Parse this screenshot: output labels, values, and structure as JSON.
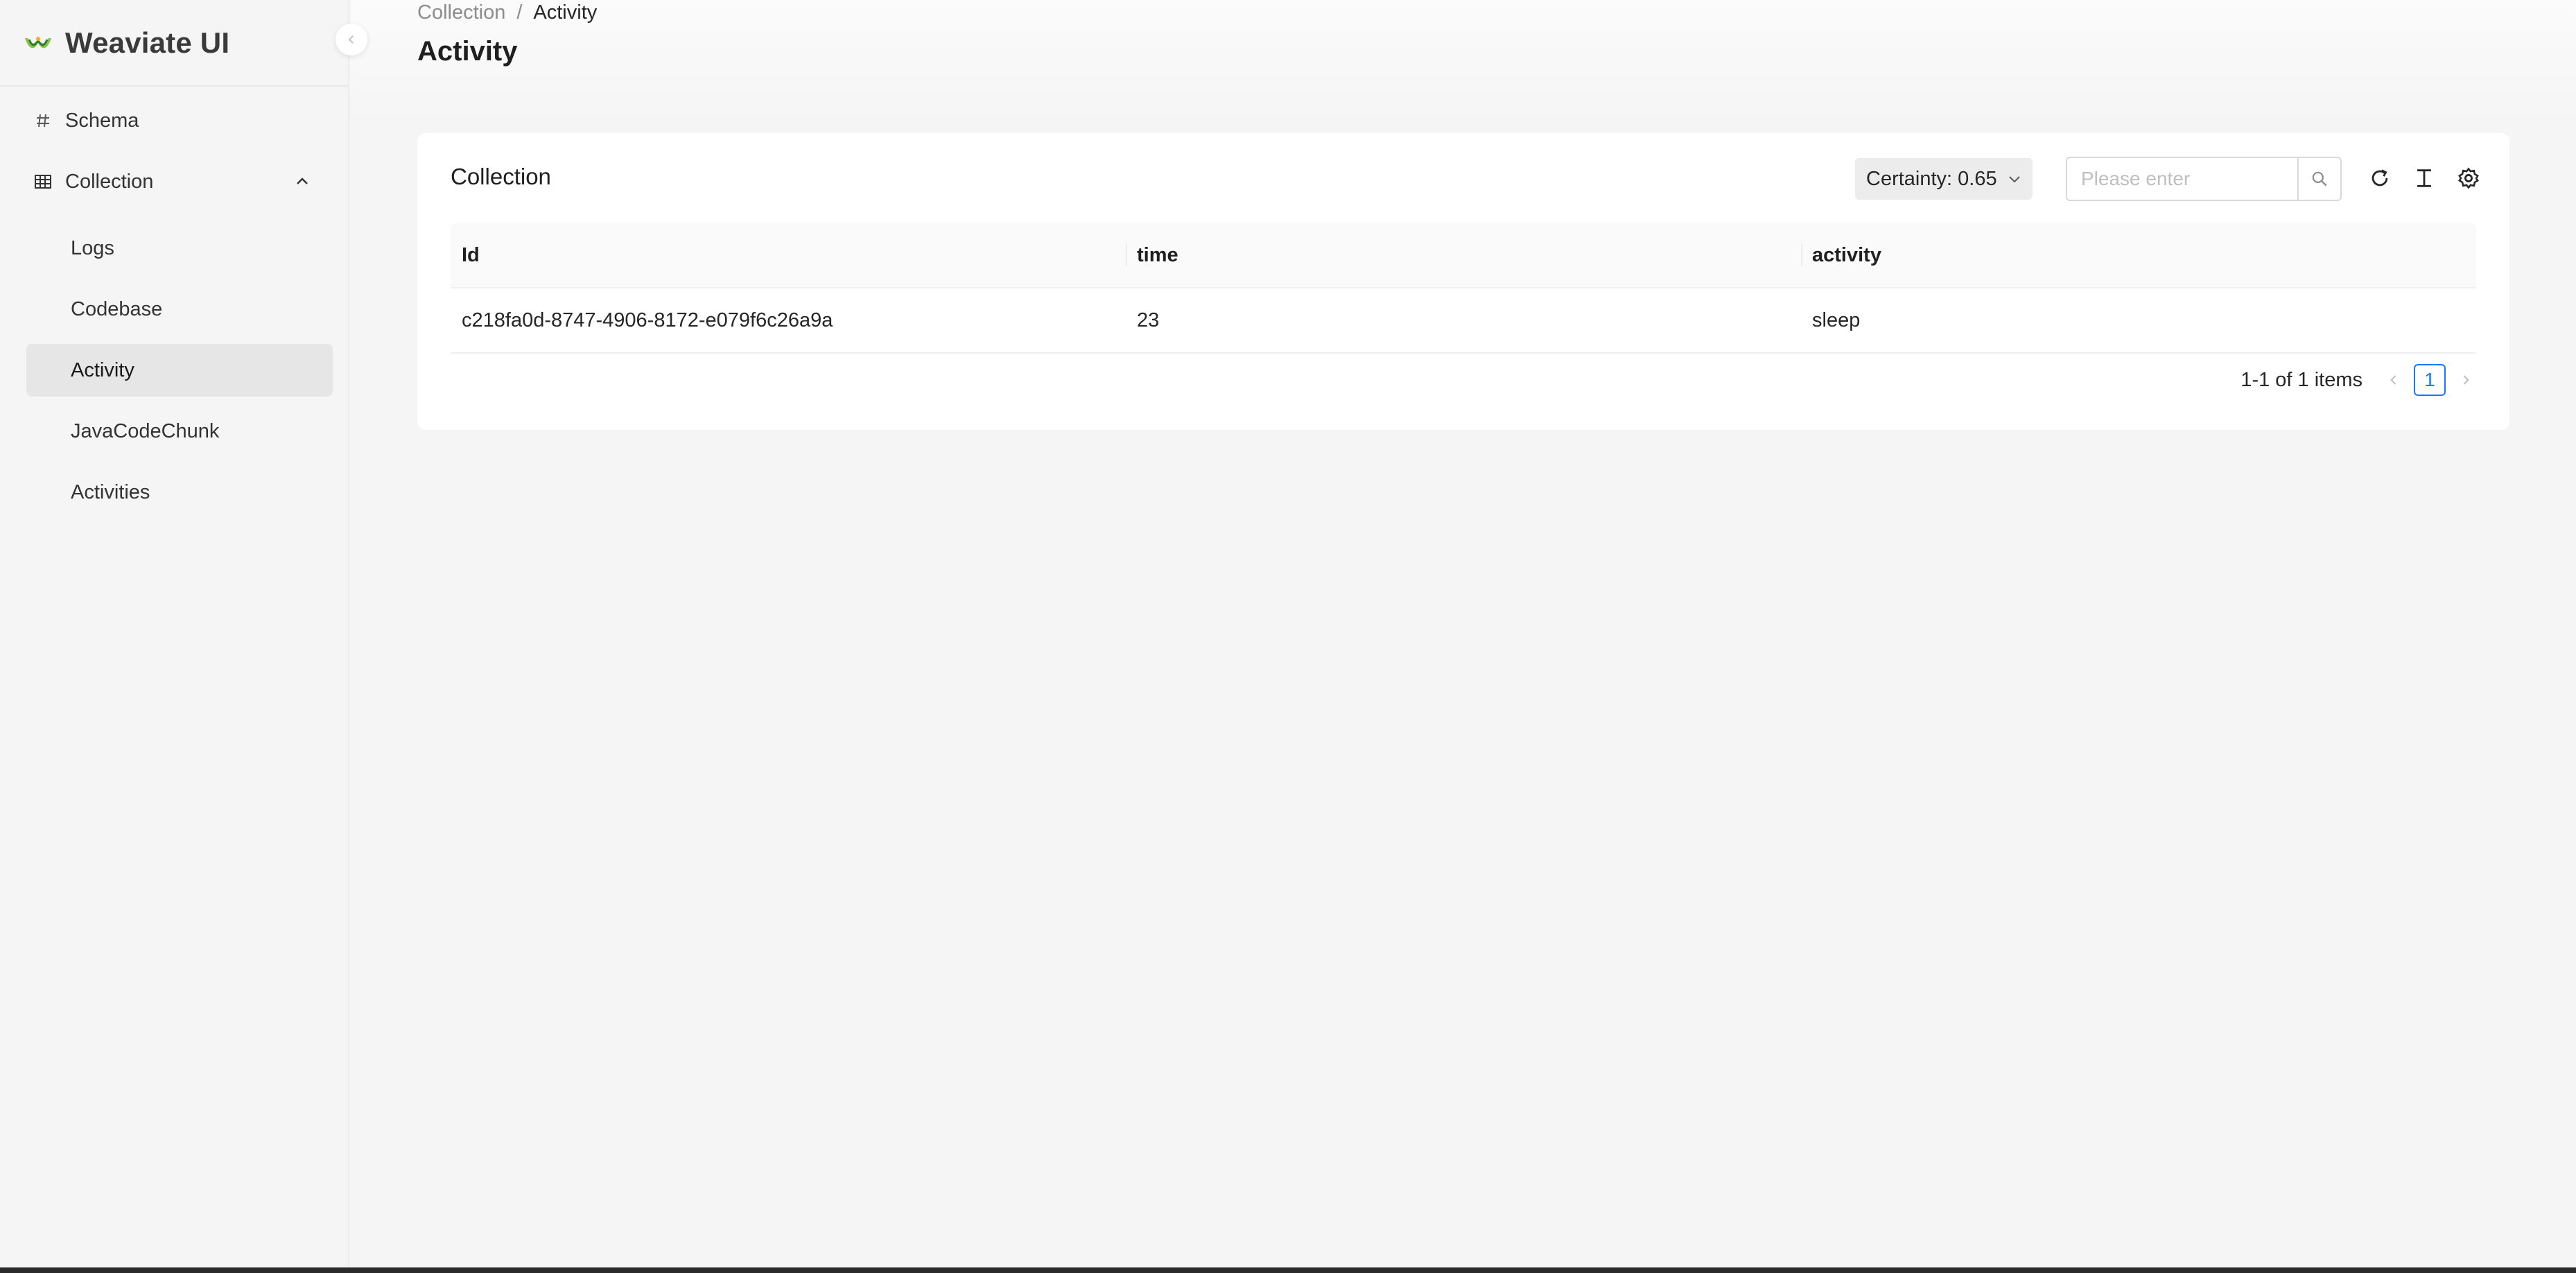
{
  "sidebar": {
    "brand": "Weaviate UI",
    "nav": {
      "schema": "Schema",
      "collection": "Collection"
    },
    "items": [
      "Logs",
      "Codebase",
      "Activity",
      "JavaCodeChunk",
      "Activities"
    ],
    "active_item": "Activity"
  },
  "breadcrumb": {
    "parent": "Collection",
    "separator": "/",
    "current": "Activity"
  },
  "page": {
    "title": "Activity"
  },
  "card": {
    "title": "Collection",
    "certainty_label": "Certainty: 0.65",
    "search_placeholder": "Please enter",
    "search_value": ""
  },
  "table": {
    "columns": [
      "Id",
      "time",
      "activity"
    ],
    "rows": [
      [
        "c218fa0d-8747-4906-8172-e079f6c26a9a",
        "23",
        "sleep"
      ]
    ]
  },
  "pagination": {
    "summary": "1-1 of 1 items",
    "current_page": "1"
  },
  "colors": {
    "accent": "#1677ff",
    "active_bg": "#e6e6e6",
    "logo_green": "#8bc34a",
    "logo_dark": "#2e7d32"
  },
  "icons": [
    "weaviate-logo",
    "collapse-chevron-left-icon",
    "hash-icon",
    "table-icon",
    "chevron-up-icon",
    "chevron-down-icon",
    "search-icon",
    "refresh-icon",
    "text-cursor-icon",
    "gear-icon",
    "chevron-left-icon",
    "chevron-right-icon"
  ]
}
